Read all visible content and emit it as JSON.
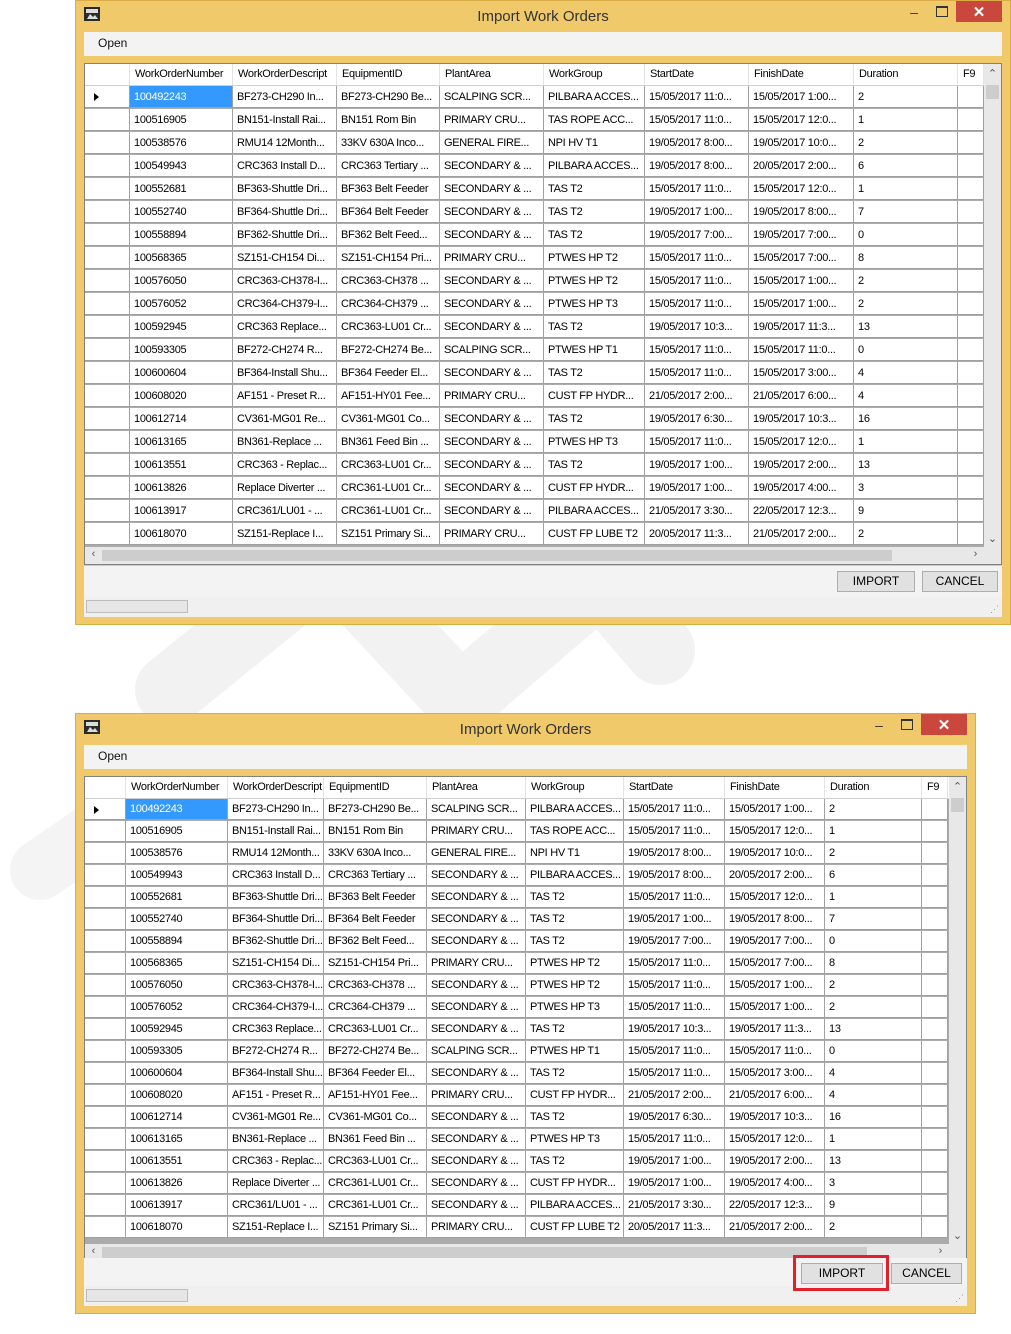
{
  "window": {
    "title": "Import Work Orders",
    "menu_open": "Open",
    "import_label": "IMPORT",
    "cancel_label": "CANCEL",
    "app_icon": "app-icon"
  },
  "colors": {
    "frame": "#f0c96a",
    "selection": "#3399ff",
    "close": "#c9473d",
    "highlight": "#e0202a"
  },
  "columns": [
    "WorkOrderNumber",
    "WorkOrderDescript",
    "EquipmentID",
    "PlantArea",
    "WorkGroup",
    "StartDate",
    "FinishDate",
    "Duration",
    "F9"
  ],
  "rows": [
    [
      "100492243",
      "BF273-CH290 In...",
      "BF273-CH290 Be...",
      "SCALPING SCR...",
      "PILBARA ACCES...",
      "15/05/2017 11:0...",
      "15/05/2017 1:00...",
      "2",
      ""
    ],
    [
      "100516905",
      "BN151-Install Rai...",
      "BN151 Rom Bin",
      "PRIMARY CRU...",
      "TAS ROPE ACC...",
      "15/05/2017 11:0...",
      "15/05/2017 12:0...",
      "1",
      ""
    ],
    [
      "100538576",
      "RMU14 12Month...",
      "33KV 630A Inco...",
      "GENERAL FIRE...",
      "NPI HV T1",
      "19/05/2017 8:00...",
      "19/05/2017 10:0...",
      "2",
      ""
    ],
    [
      "100549943",
      "CRC363 Install D...",
      "CRC363 Tertiary ...",
      "SECONDARY & ...",
      "PILBARA ACCES...",
      "19/05/2017 8:00...",
      "20/05/2017 2:00...",
      "6",
      ""
    ],
    [
      "100552681",
      "BF363-Shuttle Dri...",
      "BF363 Belt Feeder",
      "SECONDARY & ...",
      "TAS T2",
      "15/05/2017 11:0...",
      "15/05/2017 12:0...",
      "1",
      ""
    ],
    [
      "100552740",
      "BF364-Shuttle Dri...",
      "BF364 Belt Feeder",
      "SECONDARY & ...",
      "TAS T2",
      "19/05/2017 1:00...",
      "19/05/2017 8:00...",
      "7",
      ""
    ],
    [
      "100558894",
      "BF362-Shuttle Dri...",
      "BF362 Belt Feed...",
      "SECONDARY & ...",
      "TAS T2",
      "19/05/2017 7:00...",
      "19/05/2017 7:00...",
      "0",
      ""
    ],
    [
      "100568365",
      "SZ151-CH154 Di...",
      "SZ151-CH154 Pri...",
      "PRIMARY CRU...",
      "PTWES HP T2",
      "15/05/2017 11:0...",
      "15/05/2017 7:00...",
      "8",
      ""
    ],
    [
      "100576050",
      "CRC363-CH378-I...",
      "CRC363-CH378 ...",
      "SECONDARY & ...",
      "PTWES HP T2",
      "15/05/2017 11:0...",
      "15/05/2017 1:00...",
      "2",
      ""
    ],
    [
      "100576052",
      "CRC364-CH379-I...",
      "CRC364-CH379 ...",
      "SECONDARY & ...",
      "PTWES HP T3",
      "15/05/2017 11:0...",
      "15/05/2017 1:00...",
      "2",
      ""
    ],
    [
      "100592945",
      "CRC363 Replace...",
      "CRC363-LU01 Cr...",
      "SECONDARY & ...",
      "TAS T2",
      "19/05/2017 10:3...",
      "19/05/2017 11:3...",
      "13",
      ""
    ],
    [
      "100593305",
      "BF272-CH274 R...",
      "BF272-CH274 Be...",
      "SCALPING SCR...",
      "PTWES HP T1",
      "15/05/2017 11:0...",
      "15/05/2017 11:0...",
      "0",
      ""
    ],
    [
      "100600604",
      "BF364-Install Shu...",
      "BF364 Feeder El...",
      "SECONDARY & ...",
      "TAS T2",
      "15/05/2017 11:0...",
      "15/05/2017 3:00...",
      "4",
      ""
    ],
    [
      "100608020",
      "AF151 - Preset R...",
      "AF151-HY01 Fee...",
      "PRIMARY CRU...",
      "CUST FP HYDR...",
      "21/05/2017 2:00...",
      "21/05/2017 6:00...",
      "4",
      ""
    ],
    [
      "100612714",
      "CV361-MG01 Re...",
      "CV361-MG01 Co...",
      "SECONDARY & ...",
      "TAS T2",
      "19/05/2017 6:30...",
      "19/05/2017 10:3...",
      "16",
      ""
    ],
    [
      "100613165",
      "BN361-Replace ...",
      "BN361 Feed Bin ...",
      "SECONDARY & ...",
      "PTWES HP T3",
      "15/05/2017 11:0...",
      "15/05/2017 12:0...",
      "1",
      ""
    ],
    [
      "100613551",
      "CRC363 - Replac...",
      "CRC363-LU01 Cr...",
      "SECONDARY & ...",
      "TAS T2",
      "19/05/2017 1:00...",
      "19/05/2017 2:00...",
      "13",
      ""
    ],
    [
      "100613826",
      "Replace Diverter ...",
      "CRC361-LU01 Cr...",
      "SECONDARY & ...",
      "CUST FP HYDR...",
      "19/05/2017 1:00...",
      "19/05/2017 4:00...",
      "3",
      ""
    ],
    [
      "100613917",
      "CRC361/LU01 - ...",
      "CRC361-LU01 Cr...",
      "SECONDARY & ...",
      "PILBARA ACCES...",
      "21/05/2017 3:30...",
      "22/05/2017 12:3...",
      "9",
      ""
    ],
    [
      "100618070",
      "SZ151-Replace I...",
      "SZ151 Primary Si...",
      "PRIMARY CRU...",
      "CUST FP LUBE T2",
      "20/05/2017 11:3...",
      "21/05/2017 2:00...",
      "2",
      ""
    ]
  ]
}
